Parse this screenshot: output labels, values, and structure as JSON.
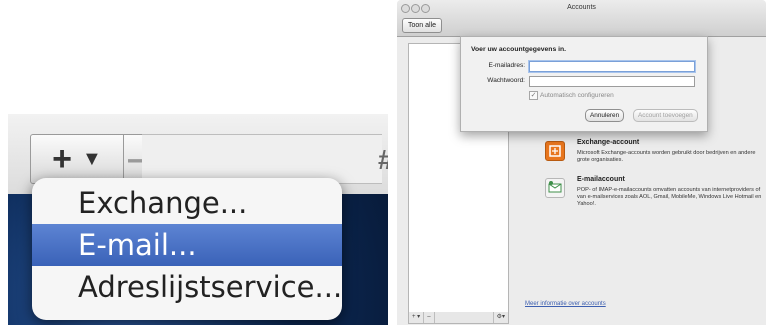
{
  "zoom_menu": {
    "plus_label": "+",
    "arrow_label": "▼",
    "minus_label": "—",
    "edge_glyph": "#",
    "items": [
      {
        "label": "Exchange...",
        "selected": false
      },
      {
        "label": "E-mail...",
        "selected": true
      },
      {
        "label": "Adreslijstservice...",
        "selected": false
      }
    ]
  },
  "window": {
    "title": "Accounts",
    "show_all_button": "Toon alle",
    "toolbar_buttons": {
      "add": "+ ▾",
      "remove": "–",
      "gear": "⚙▾"
    },
    "more_info_link": "Meer informatie over accounts"
  },
  "dialog": {
    "title": "Voer uw accountgegevens in.",
    "email_label": "E-mailadres:",
    "email_value": "",
    "password_label": "Wachtwoord:",
    "password_value": "",
    "auto_configure_label": "Automatisch configureren",
    "auto_configure_checked": true,
    "cancel_button": "Annuleren",
    "add_account_button": "Account toevoegen"
  },
  "account_types": [
    {
      "name": "Exchange-account",
      "description": "Microsoft Exchange-accounts worden gebruikt door bedrijven en andere grote organisaties.",
      "icon": "exchange-icon",
      "color": "#e8761e"
    },
    {
      "name": "E-mailaccount",
      "description": "POP- of IMAP-e-mailaccounts omvatten accounts van internetproviders of van e-mailservices zoals AOL, Gmail, MobileMe, Windows Live Hotmail en Yahoo!.",
      "icon": "mail-account-icon",
      "color": "#3f8f4a"
    }
  ],
  "colors": {
    "selection": "#3a62b8",
    "link": "#3d5fb0"
  }
}
